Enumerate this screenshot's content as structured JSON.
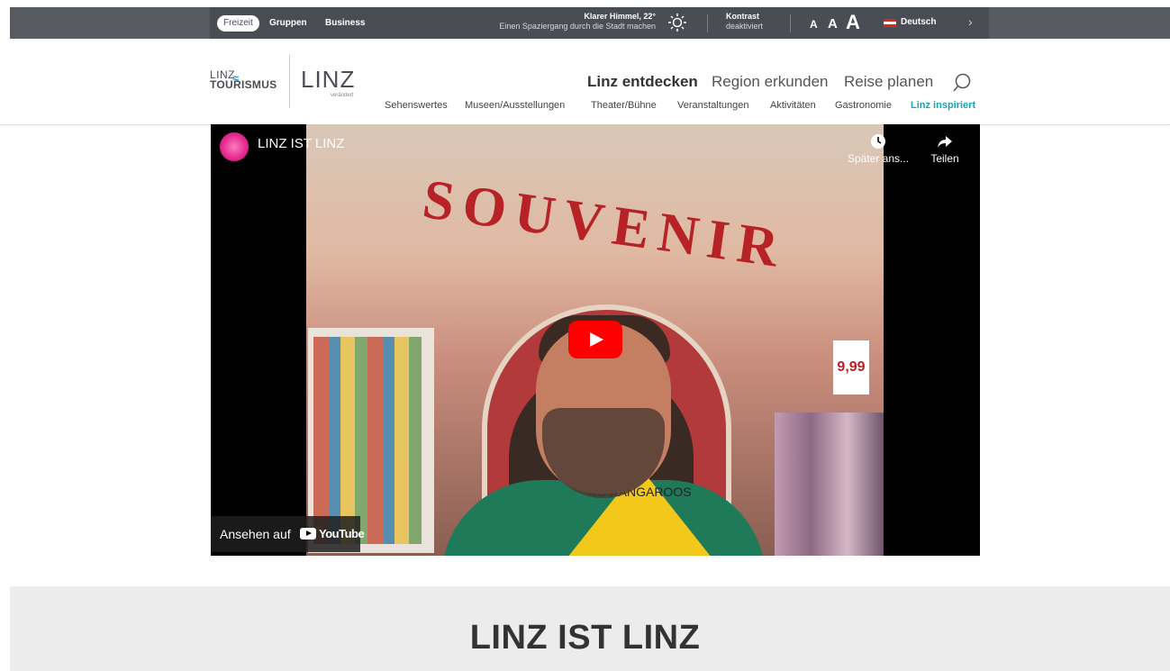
{
  "topbar": {
    "audiences": [
      "Freizeit",
      "Gruppen",
      "Business"
    ],
    "weather_title": "Klarer Himmel, 22°",
    "weather_sub": "Einen Spaziergang durch die Stadt machen",
    "contrast_title": "Kontrast",
    "contrast_sub": "deaktiviert",
    "font_sizes": [
      "A",
      "A",
      "A"
    ],
    "language": "Deutsch",
    "next": "›"
  },
  "logos": {
    "tourism_line1": "LINZ",
    "tourism_line2": "TOURISMUS",
    "city": "LINZ",
    "city_sub": "verändert"
  },
  "main_nav": [
    "Linz entdecken",
    "Region erkunden",
    "Reise planen"
  ],
  "sub_nav": [
    "Sehenswertes",
    "Museen/Ausstellungen",
    "Theater/Bühne",
    "Veranstaltungen",
    "Aktivitäten",
    "Gastronomie",
    "Linz inspiriert"
  ],
  "video": {
    "title": "LINZ IST LINZ",
    "watch_later": "Später ans...",
    "share": "Teilen",
    "watch_on": "Ansehen auf",
    "youtube": "YouTube",
    "scene_sign": "SOUVENIR",
    "shirt_text": "NO KANGAROOS",
    "price_tag": "9,99"
  },
  "section": {
    "heading": "LINZ IST LINZ"
  },
  "colors": {
    "topbar": "#4a4e54",
    "accent_teal": "#1aa4ae",
    "youtube_red": "#ff0000"
  }
}
